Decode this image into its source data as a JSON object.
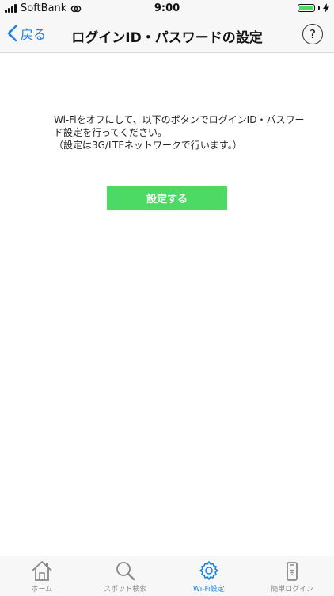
{
  "status_bar": {
    "carrier": "SoftBank",
    "time": "9:00"
  },
  "nav_bar": {
    "back_label": "戻る",
    "title": "ログインID・パスワードの設定",
    "help_label": "?"
  },
  "main": {
    "message_line1": "Wi-Fiをオフにして、以下のボタンでログインID・パスワード設定を行ってください。",
    "message_line2": "（設定は3G/LTEネットワークで行います。）",
    "button_label": "設定する"
  },
  "tab_bar": {
    "tabs": [
      {
        "label": "ホーム",
        "icon": "home-icon",
        "active": false
      },
      {
        "label": "スポット検索",
        "icon": "search-icon",
        "active": false
      },
      {
        "label": "Wi-Fi設定",
        "icon": "gear-icon",
        "active": true
      },
      {
        "label": "簡単ログイン",
        "icon": "phone-icon",
        "active": false
      }
    ]
  },
  "colors": {
    "accent": "#1a82e6",
    "button": "#4cd964"
  }
}
